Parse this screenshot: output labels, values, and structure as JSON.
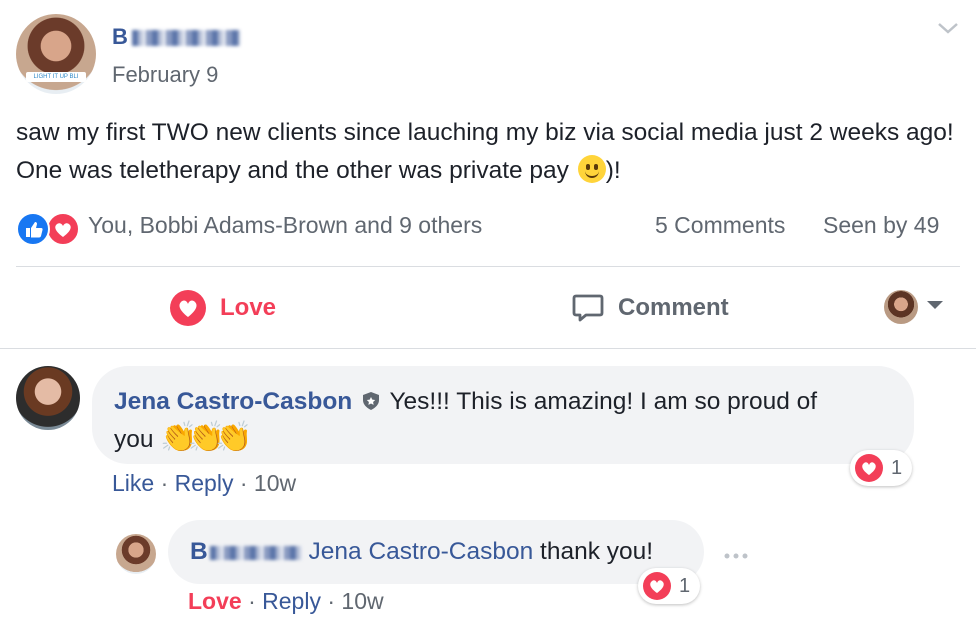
{
  "post": {
    "author_name": "B",
    "date": "February 9",
    "text": "saw my first TWO new clients since lauching my biz via social media just 2 weeks ago! One was teletherapy and the other was private pay",
    "text_suffix": ")!",
    "avatar_banner": "LIGHT IT UP BLI"
  },
  "reactions": {
    "names": "You, Bobbi Adams-Brown and 9 others",
    "comments_count": "5 Comments",
    "seen_by": "Seen by 49"
  },
  "actions": {
    "love_label": "Love",
    "comment_label": "Comment"
  },
  "comments": [
    {
      "author": "Jena Castro-Casbon",
      "text": "Yes!!! This is amazing! I am so proud of",
      "text_line2": "you",
      "emoji": "👏👏👏",
      "like_label": "Like",
      "reply_label": "Reply",
      "time": "10w",
      "reaction_count": "1",
      "sep": "·"
    },
    {
      "author_prefix": "B",
      "mention": "Jena Castro-Casbon",
      "text": "thank you!",
      "love_label": "Love",
      "reply_label": "Reply",
      "time": "10w",
      "reaction_count": "1",
      "sep": "·"
    }
  ],
  "colors": {
    "link": "#385898",
    "love": "#f33e58",
    "like_blue": "#1877f2",
    "bubble": "#f2f3f5",
    "muted": "#606770"
  }
}
